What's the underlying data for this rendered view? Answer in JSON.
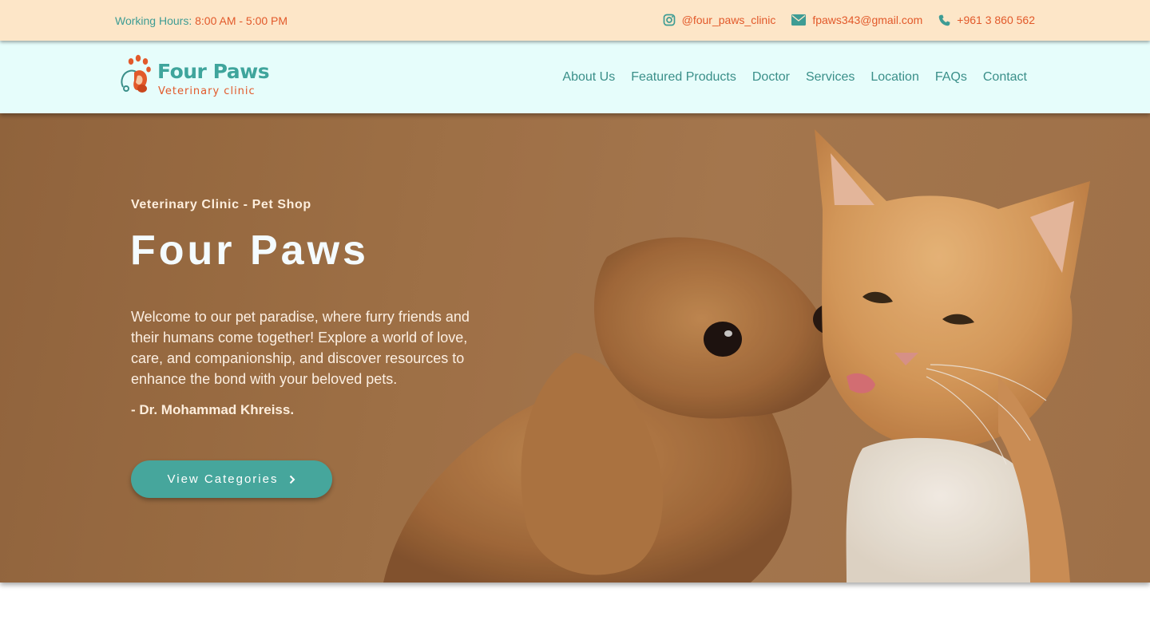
{
  "topbar": {
    "hours_label": "Working Hours:",
    "hours_value": "8:00 AM - 5:00 PM",
    "instagram": "@four_paws_clinic",
    "email": "fpaws343@gmail.com",
    "phone": "+961 3 860 562",
    "icons": [
      "instagram-icon",
      "envelope-icon",
      "phone-icon"
    ]
  },
  "brand": {
    "name": "Four Paws",
    "subtitle": "Veterinary clinic",
    "colors": {
      "teal": "#3fa59c",
      "orange": "#e2592a"
    }
  },
  "nav": {
    "items": [
      {
        "label": "About Us"
      },
      {
        "label": "Featured Products"
      },
      {
        "label": "Doctor"
      },
      {
        "label": "Services"
      },
      {
        "label": "Location"
      },
      {
        "label": "FAQs"
      },
      {
        "label": "Contact"
      }
    ]
  },
  "hero": {
    "tagline": "Veterinary Clinic - Pet Shop",
    "title": "Four Paws",
    "text": "Welcome to our pet paradise, where furry friends and their humans come together! Explore a world of love, care, and companionship, and discover resources to enhance the bond with your beloved pets.",
    "signature": "- Dr. Mohammad Khreiss.",
    "cta_label": "View Categories",
    "cta_icon": "chevron-right-icon"
  }
}
